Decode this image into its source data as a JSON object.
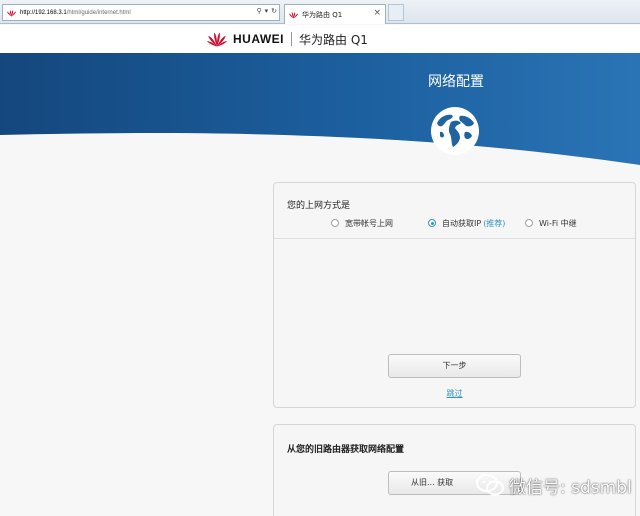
{
  "browser": {
    "url_host": "http://192.168.3.1",
    "url_path": "/html/guide/internet.html",
    "tab_title": "华为路由 Q1",
    "close_glyph": "×"
  },
  "header": {
    "brand_name": "HUAWEI",
    "product_name": "华为路由 Q1"
  },
  "hero": {
    "title": "网络配置"
  },
  "connection_card": {
    "title": "您的上网方式是",
    "options": [
      {
        "label": "宽带帐号上网",
        "tag": "",
        "selected": false
      },
      {
        "label": "自动获取IP",
        "tag": "(推荐)",
        "selected": true
      },
      {
        "label": "Wi-Fi 中继",
        "tag": "",
        "selected": false
      }
    ],
    "next_label": "下一步",
    "skip_label": "跳过"
  },
  "old_router_card": {
    "title": "从您的旧路由器获取网络配置",
    "button_label": "从旧... 获取"
  },
  "watermark": {
    "text": "微信号: sdsmbl"
  },
  "colors": {
    "hero_blue": "#1c5f9f",
    "hero_dark": "#14477d",
    "accent": "#2f93c5",
    "brand_red": "#cf0a2c"
  }
}
